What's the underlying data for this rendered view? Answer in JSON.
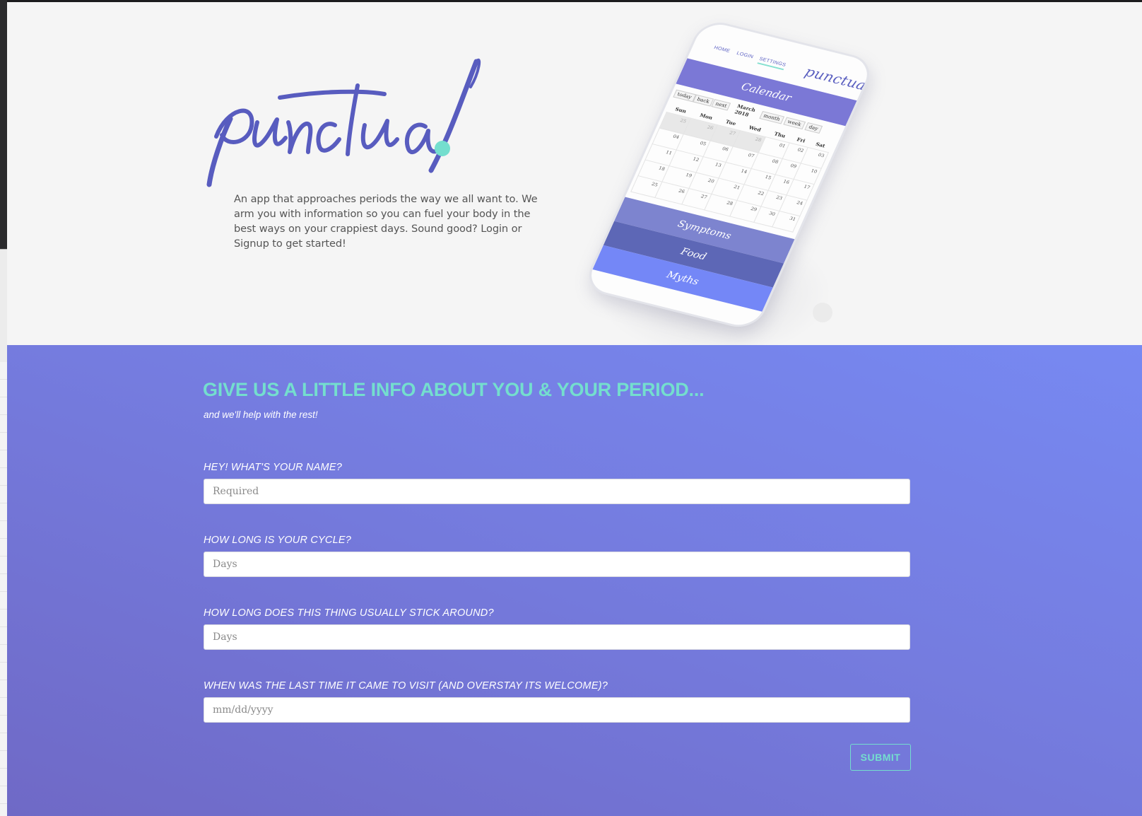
{
  "brand": {
    "logo_text": "punctual",
    "accent_dot_color": "#74dece",
    "logo_color": "#585cbf"
  },
  "hero": {
    "intro": "An app that approaches periods the way we all want to. We arm you with information so you can fuel your body in the best ways on your crappiest days. Sound good? Login or Signup to get started!"
  },
  "phone": {
    "nav": {
      "home": "HOME",
      "login": "LOGIN",
      "settings": "SETTINGS",
      "logo": "punctual"
    },
    "calendar_title": "Calendar",
    "toolbar": {
      "today": "today",
      "back": "back",
      "next": "next",
      "month_label": "March 2018",
      "month": "month",
      "week": "week",
      "day": "day"
    },
    "weekdays": [
      "Sun",
      "Mon",
      "Tue",
      "Wed",
      "Thu",
      "Fri",
      "Sat"
    ],
    "weeks": [
      [
        "25",
        "26",
        "27",
        "28",
        "01",
        "02",
        "03"
      ],
      [
        "04",
        "05",
        "06",
        "07",
        "08",
        "09",
        "10"
      ],
      [
        "11",
        "12",
        "13",
        "14",
        "15",
        "16",
        "17"
      ],
      [
        "18",
        "19",
        "20",
        "21",
        "22",
        "23",
        "24"
      ],
      [
        "25",
        "26",
        "27",
        "28",
        "29",
        "30",
        "31"
      ]
    ],
    "sections": [
      "Symptoms",
      "Food",
      "Myths"
    ]
  },
  "form": {
    "heading": "GIVE US A LITTLE INFO ABOUT YOU & YOUR PERIOD...",
    "subheading": "and we'll help with the rest!",
    "fields": [
      {
        "label": "HEY! WHAT'S YOUR NAME?",
        "placeholder": "Required",
        "value": ""
      },
      {
        "label": "HOW LONG IS YOUR CYCLE?",
        "placeholder": "Days",
        "value": ""
      },
      {
        "label": "HOW LONG DOES THIS THING USUALLY STICK AROUND?",
        "placeholder": "Days",
        "value": ""
      },
      {
        "label": "WHEN WAS THE LAST TIME IT CAME TO VISIT (AND OVERSTAY ITS WELCOME)?",
        "placeholder": "mm/dd/yyyy",
        "value": ""
      }
    ],
    "submit": "SUBMIT"
  },
  "colors": {
    "accent": "#74dece",
    "brand": "#585cbf",
    "gradient_top": "#7789f2",
    "gradient_bottom": "#6f69c6"
  }
}
